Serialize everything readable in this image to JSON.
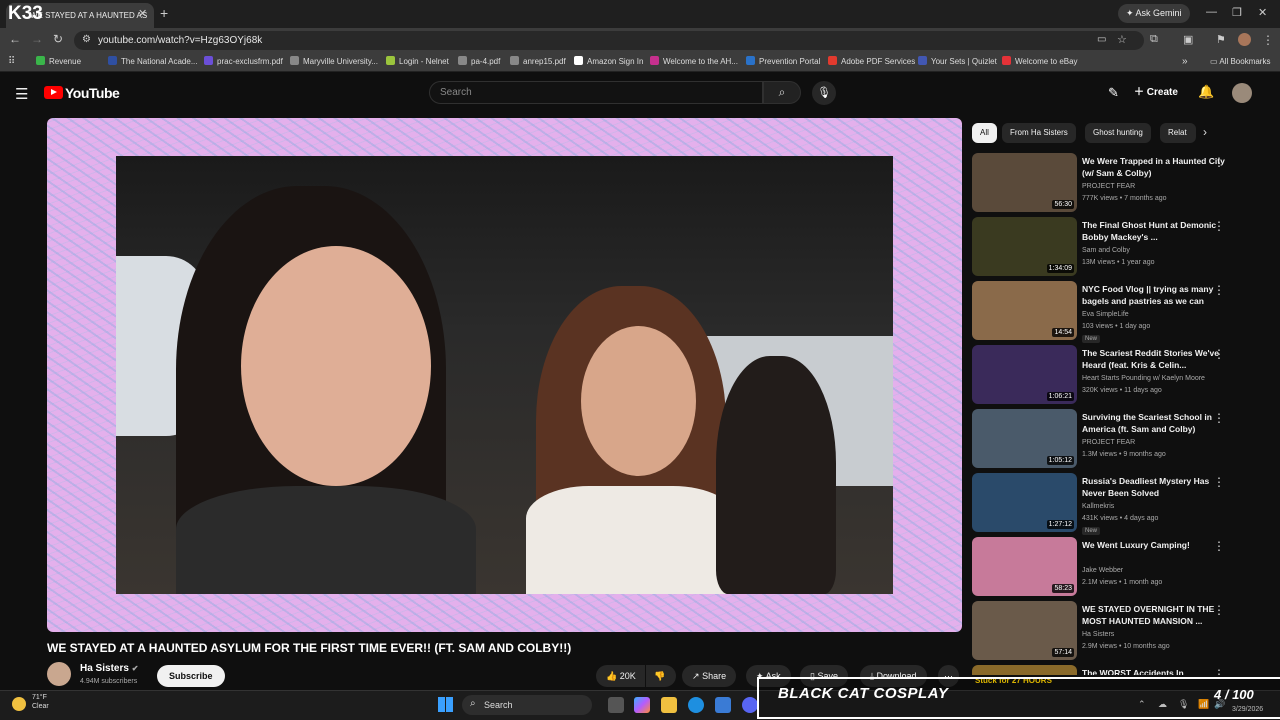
{
  "browser": {
    "tab_title": "WE STAYED AT A HAUNTED AS",
    "overlay_logo": "K33",
    "ask_gemini": "Ask Gemini",
    "url": "youtube.com/watch?v=Hzg63OYj68k",
    "bookmarks": [
      {
        "label": "Revenue",
        "color": "#3ab54a"
      },
      {
        "label": "The National Acade...",
        "color": "#2f4fa1"
      },
      {
        "label": "prac-exclusfrm.pdf",
        "color": "#6b4fd8"
      },
      {
        "label": "Maryville University...",
        "color": "#888888"
      },
      {
        "label": "Login - Nelnet",
        "color": "#9bc53d"
      },
      {
        "label": "pa-4.pdf",
        "color": "#888888"
      },
      {
        "label": "anrep15.pdf",
        "color": "#888888"
      },
      {
        "label": "Amazon Sign In",
        "color": "#ffffff"
      },
      {
        "label": "Welcome to the AH...",
        "color": "#c6308e"
      },
      {
        "label": "Prevention Portal",
        "color": "#2a72c9"
      },
      {
        "label": "Adobe PDF Services",
        "color": "#e23a2e"
      },
      {
        "label": "Your Sets | Quizlet",
        "color": "#4257b2"
      },
      {
        "label": "Welcome to eBay",
        "color": "#e53238"
      }
    ],
    "all_bookmarks": "All Bookmarks"
  },
  "youtube": {
    "logo": "YouTube",
    "search_placeholder": "Search",
    "create": "Create",
    "video": {
      "title": "WE STAYED AT A HAUNTED ASYLUM FOR THE FIRST TIME EVER!! (FT. SAM AND COLBY!!)",
      "channel": "Ha Sisters",
      "subscribers": "4.94M subscribers",
      "subscribe": "Subscribe",
      "likes": "20K",
      "share": "Share",
      "ask": "Ask",
      "save": "Save",
      "download": "Download"
    },
    "chips": [
      "All",
      "From Ha Sisters",
      "Ghost hunting",
      "Relat"
    ],
    "recommendations": [
      {
        "title": "We Were Trapped in a Haunted City (w/ Sam & Colby)",
        "channel": "PROJECT FEAR",
        "meta": "777K views • 7 months ago",
        "duration": "56:30",
        "new": "",
        "color": "#5a4a3a"
      },
      {
        "title": "The Final Ghost Hunt at Demonic Bobby Mackey's ...",
        "channel": "Sam and Colby",
        "meta": "13M views • 1 year ago",
        "duration": "1:34:09",
        "new": "",
        "color": "#3a3a20"
      },
      {
        "title": "NYC Food Vlog || trying as many bagels and pastries as we can",
        "channel": "Eva SimpleLife",
        "meta": "103 views • 1 day ago",
        "duration": "14:54",
        "new": "New",
        "color": "#8a6a4a"
      },
      {
        "title": "The Scariest Reddit Stories We've Heard (feat. Kris & Celin...",
        "channel": "Heart Starts Pounding w/ Kaelyn Moore",
        "meta": "320K views • 11 days ago",
        "duration": "1:06:21",
        "new": "",
        "color": "#3a2a5a"
      },
      {
        "title": "Surviving the Scariest School in America (ft. Sam and Colby)",
        "channel": "PROJECT FEAR",
        "meta": "1.3M views • 9 months ago",
        "duration": "1:05:12",
        "new": "",
        "color": "#4a5a6a"
      },
      {
        "title": "Russia's Deadliest Mystery Has Never Been Solved",
        "channel": "Kallmekris",
        "meta": "431K views • 4 days ago",
        "duration": "1:27:12",
        "new": "New",
        "color": "#2a4a6a"
      },
      {
        "title": "We Went Luxury Camping!",
        "channel": "Jake Webber",
        "meta": "2.1M views • 1 month ago",
        "duration": "58:23",
        "new": "",
        "color": "#c77a9a"
      },
      {
        "title": "WE STAYED OVERNIGHT IN THE MOST HAUNTED MANSION ...",
        "channel": "Ha Sisters",
        "meta": "2.9M views • 10 months ago",
        "duration": "57:14",
        "new": "",
        "color": "#6a5a4a"
      },
      {
        "title": "The WORST Accidents In",
        "channel": "",
        "meta": "",
        "duration": "",
        "new": "",
        "color": "#8a6a2a"
      }
    ],
    "stuck_label": "Stuck for 27 HOURS"
  },
  "taskbar": {
    "temp": "71°F",
    "weather": "Clear",
    "search": "Search",
    "time": "3/29/2026"
  },
  "stream_overlay": {
    "title": "BLACK CAT COSPLAY",
    "count": "4 / 100"
  }
}
